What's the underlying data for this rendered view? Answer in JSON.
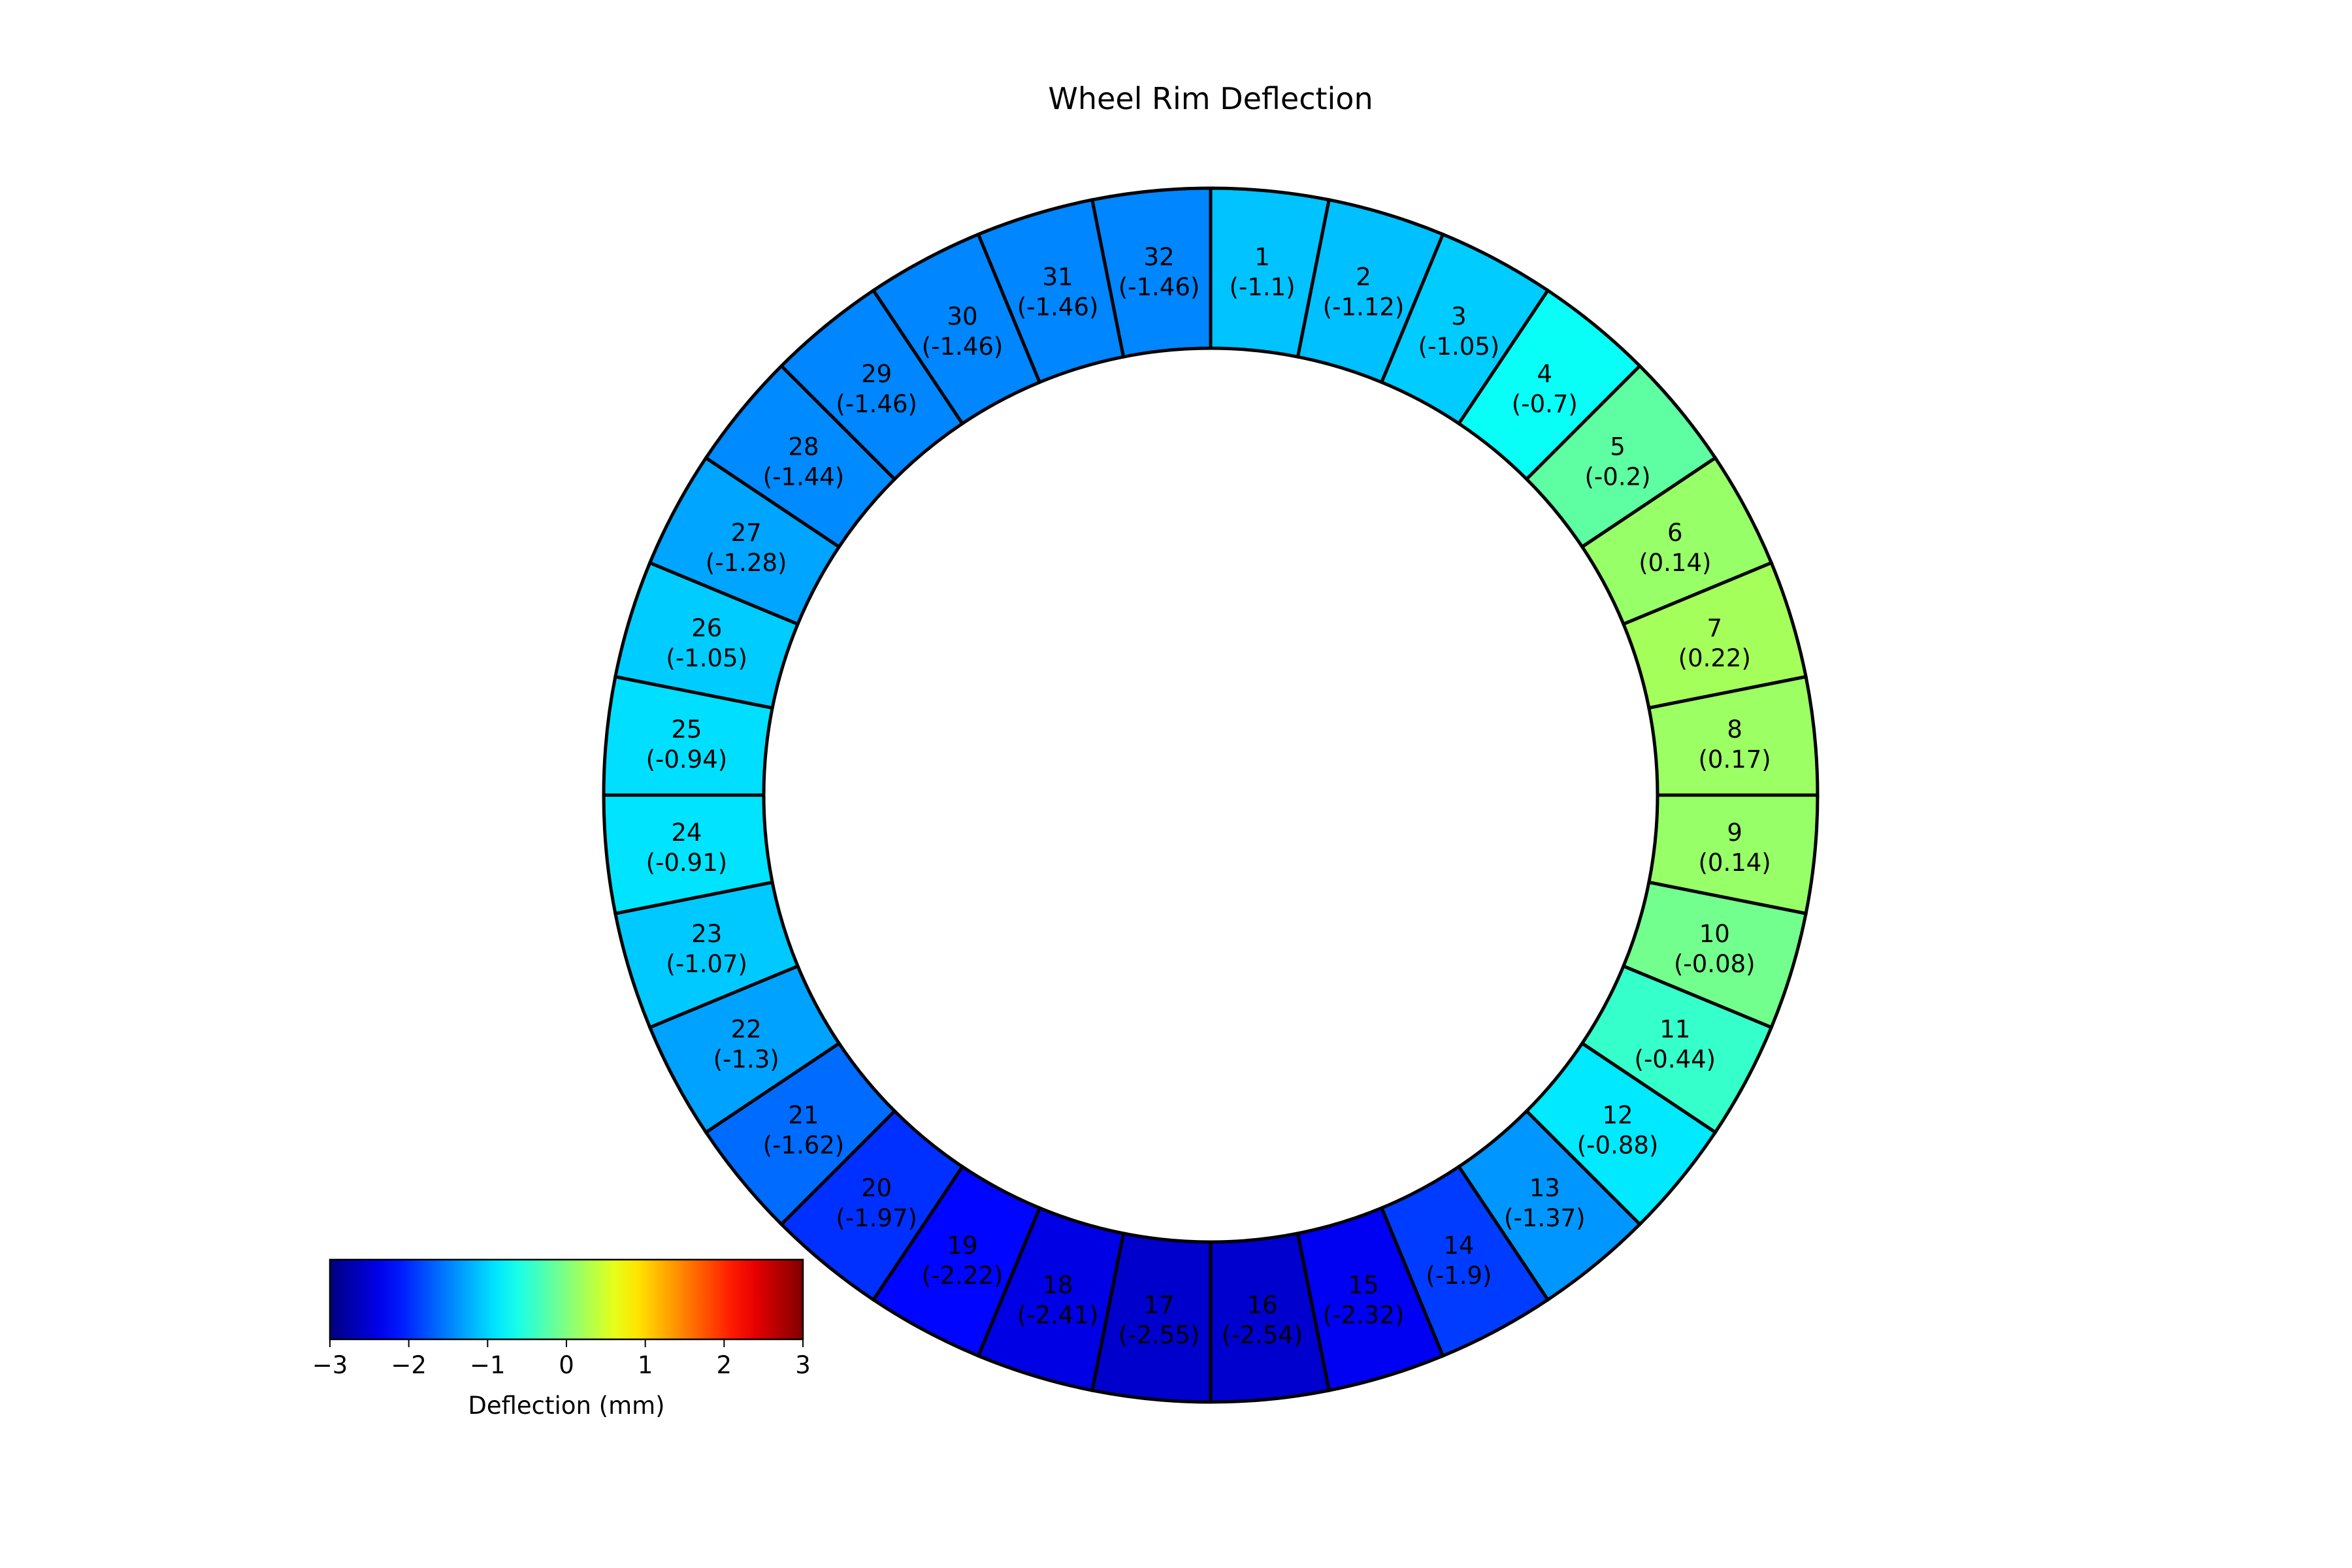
{
  "chart_data": {
    "type": "ring",
    "title": "Wheel Rim Deflection",
    "segments": [
      {
        "id": "1",
        "value": -1.1,
        "value_label": "(-1.1)"
      },
      {
        "id": "2",
        "value": -1.12,
        "value_label": "(-1.12)"
      },
      {
        "id": "3",
        "value": -1.05,
        "value_label": "(-1.05)"
      },
      {
        "id": "4",
        "value": -0.7,
        "value_label": "(-0.7)"
      },
      {
        "id": "5",
        "value": -0.2,
        "value_label": "(-0.2)"
      },
      {
        "id": "6",
        "value": 0.14,
        "value_label": "(0.14)"
      },
      {
        "id": "7",
        "value": 0.22,
        "value_label": "(0.22)"
      },
      {
        "id": "8",
        "value": 0.17,
        "value_label": "(0.17)"
      },
      {
        "id": "9",
        "value": 0.14,
        "value_label": "(0.14)"
      },
      {
        "id": "10",
        "value": -0.08,
        "value_label": "(-0.08)"
      },
      {
        "id": "11",
        "value": -0.44,
        "value_label": "(-0.44)"
      },
      {
        "id": "12",
        "value": -0.88,
        "value_label": "(-0.88)"
      },
      {
        "id": "13",
        "value": -1.37,
        "value_label": "(-1.37)"
      },
      {
        "id": "14",
        "value": -1.9,
        "value_label": "(-1.9)"
      },
      {
        "id": "15",
        "value": -2.32,
        "value_label": "(-2.32)"
      },
      {
        "id": "16",
        "value": -2.54,
        "value_label": "(-2.54)"
      },
      {
        "id": "17",
        "value": -2.55,
        "value_label": "(-2.55)"
      },
      {
        "id": "18",
        "value": -2.41,
        "value_label": "(-2.41)"
      },
      {
        "id": "19",
        "value": -2.22,
        "value_label": "(-2.22)"
      },
      {
        "id": "20",
        "value": -1.97,
        "value_label": "(-1.97)"
      },
      {
        "id": "21",
        "value": -1.62,
        "value_label": "(-1.62)"
      },
      {
        "id": "22",
        "value": -1.3,
        "value_label": "(-1.3)"
      },
      {
        "id": "23",
        "value": -1.07,
        "value_label": "(-1.07)"
      },
      {
        "id": "24",
        "value": -0.91,
        "value_label": "(-0.91)"
      },
      {
        "id": "25",
        "value": -0.94,
        "value_label": "(-0.94)"
      },
      {
        "id": "26",
        "value": -1.05,
        "value_label": "(-1.05)"
      },
      {
        "id": "27",
        "value": -1.28,
        "value_label": "(-1.28)"
      },
      {
        "id": "28",
        "value": -1.44,
        "value_label": "(-1.44)"
      },
      {
        "id": "29",
        "value": -1.46,
        "value_label": "(-1.46)"
      },
      {
        "id": "30",
        "value": -1.46,
        "value_label": "(-1.46)"
      },
      {
        "id": "31",
        "value": -1.46,
        "value_label": "(-1.46)"
      },
      {
        "id": "32",
        "value": -1.46,
        "value_label": "(-1.46)"
      }
    ],
    "direction": "clockwise",
    "start": "top",
    "colorbar": {
      "label": "Deflection (mm)",
      "colormap": "jet",
      "range": [
        -3,
        3
      ],
      "ticks": [
        -3,
        -2,
        -1,
        0,
        1,
        2,
        3
      ],
      "tick_labels": [
        "−3",
        "−2",
        "−1",
        "0",
        "1",
        "2",
        "3"
      ],
      "orientation": "horizontal",
      "placement": "bottom-left"
    },
    "colors": {
      "segment_edge": "#000000",
      "background": "#ffffff"
    }
  }
}
